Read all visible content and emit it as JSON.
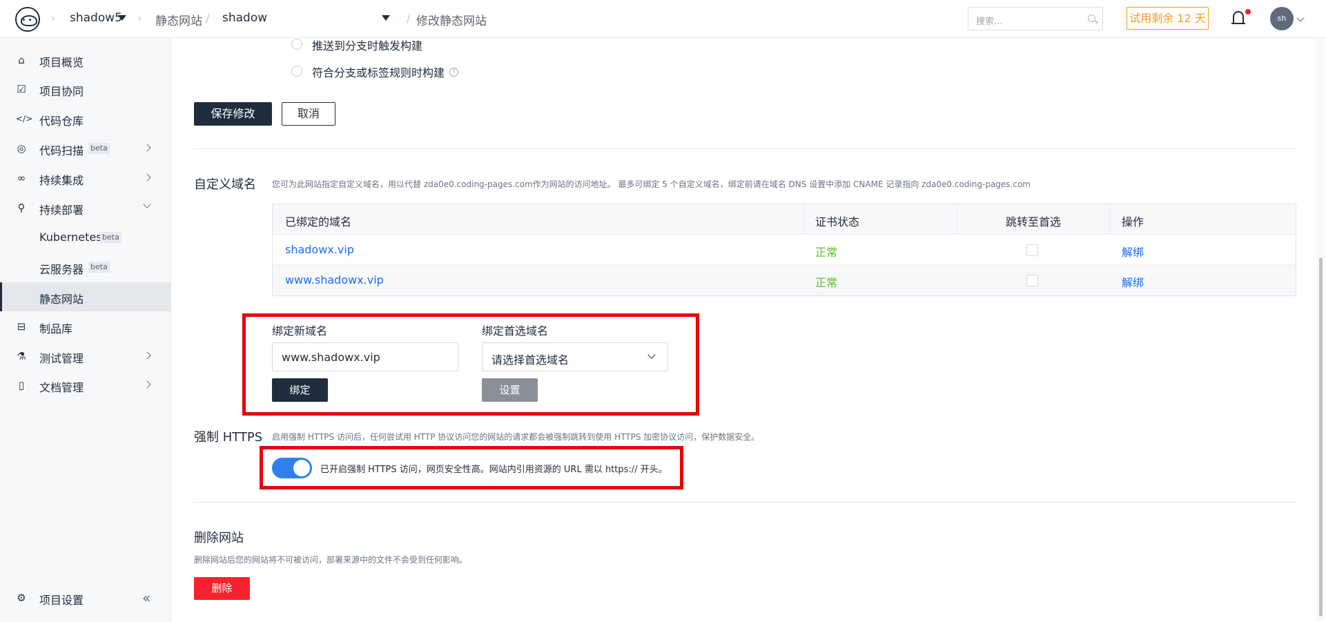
{
  "header": {
    "project": "shadow5",
    "section": "静态网站",
    "site": "shadow",
    "page": "修改静态网站",
    "search_placeholder": "搜索...",
    "trial": "试用剩余 12 天",
    "avatar": "sh"
  },
  "sidebar": {
    "items": [
      {
        "label": "项目概览",
        "icon": "home-icon"
      },
      {
        "label": "项目协同",
        "icon": "checkbox-icon"
      },
      {
        "label": "代码仓库",
        "icon": "code-icon"
      },
      {
        "label": "代码扫描",
        "badge": "beta",
        "icon": "scan-icon"
      },
      {
        "label": "持续集成",
        "icon": "infinity-icon"
      },
      {
        "label": "持续部署",
        "icon": "rocket-icon"
      },
      {
        "label": "Kubernetes",
        "badge": "beta"
      },
      {
        "label": "云服务器",
        "badge": "beta"
      },
      {
        "label": "静态网站"
      },
      {
        "label": "制品库",
        "icon": "package-icon"
      },
      {
        "label": "测试管理",
        "icon": "flask-icon"
      },
      {
        "label": "文档管理",
        "icon": "document-icon"
      }
    ],
    "settings": "项目设置"
  },
  "build": {
    "option1": "推送到分支时触发构建",
    "option2": "符合分支或标签规则时构建",
    "save": "保存修改",
    "cancel": "取消"
  },
  "domain": {
    "title": "自定义域名",
    "desc": "您可为此网站指定自定义域名，用以代替 zda0e0.coding-pages.com作为网站的访问地址。 最多可绑定 5 个自定义域名，绑定前请在域名 DNS 设置中添加 CNAME 记录指向 zda0e0.coding-pages.com",
    "columns": [
      "已绑定的域名",
      "证书状态",
      "跳转至首选",
      "操作"
    ],
    "rows": [
      {
        "domain": "shadowx.vip",
        "status": "正常",
        "action": "解绑"
      },
      {
        "domain": "www.shadowx.vip",
        "status": "正常",
        "action": "解绑"
      }
    ],
    "new_label": "绑定新域名",
    "new_value": "www.shadowx.vip",
    "bind": "绑定",
    "preferred_label": "绑定首选域名",
    "preferred_placeholder": "请选择首选域名",
    "set": "设置"
  },
  "https": {
    "title": "强制 HTTPS",
    "desc": "启用强制 HTTPS 访问后，任何尝试用 HTTP 协议访问您的网站的请求都会被强制跳转到使用 HTTPS 加密协议访问，保护数据安全。",
    "enabled": true,
    "toggle_text": "已开启强制 HTTPS 访问，网页安全性高。网站内引用资源的 URL 需以 https:// 开头。"
  },
  "delete": {
    "title": "删除网站",
    "desc": "删除网站后您的网站将不可被访问，部署来源中的文件不会受到任何影响。",
    "button": "删除"
  },
  "colors": {
    "primary": "#1f2d3d",
    "link": "#1a6cf0",
    "success": "#52c41a",
    "danger": "#f5222d",
    "warning": "#f59a23",
    "toggle": "#2f80ed",
    "highlight": "#e8000b"
  }
}
